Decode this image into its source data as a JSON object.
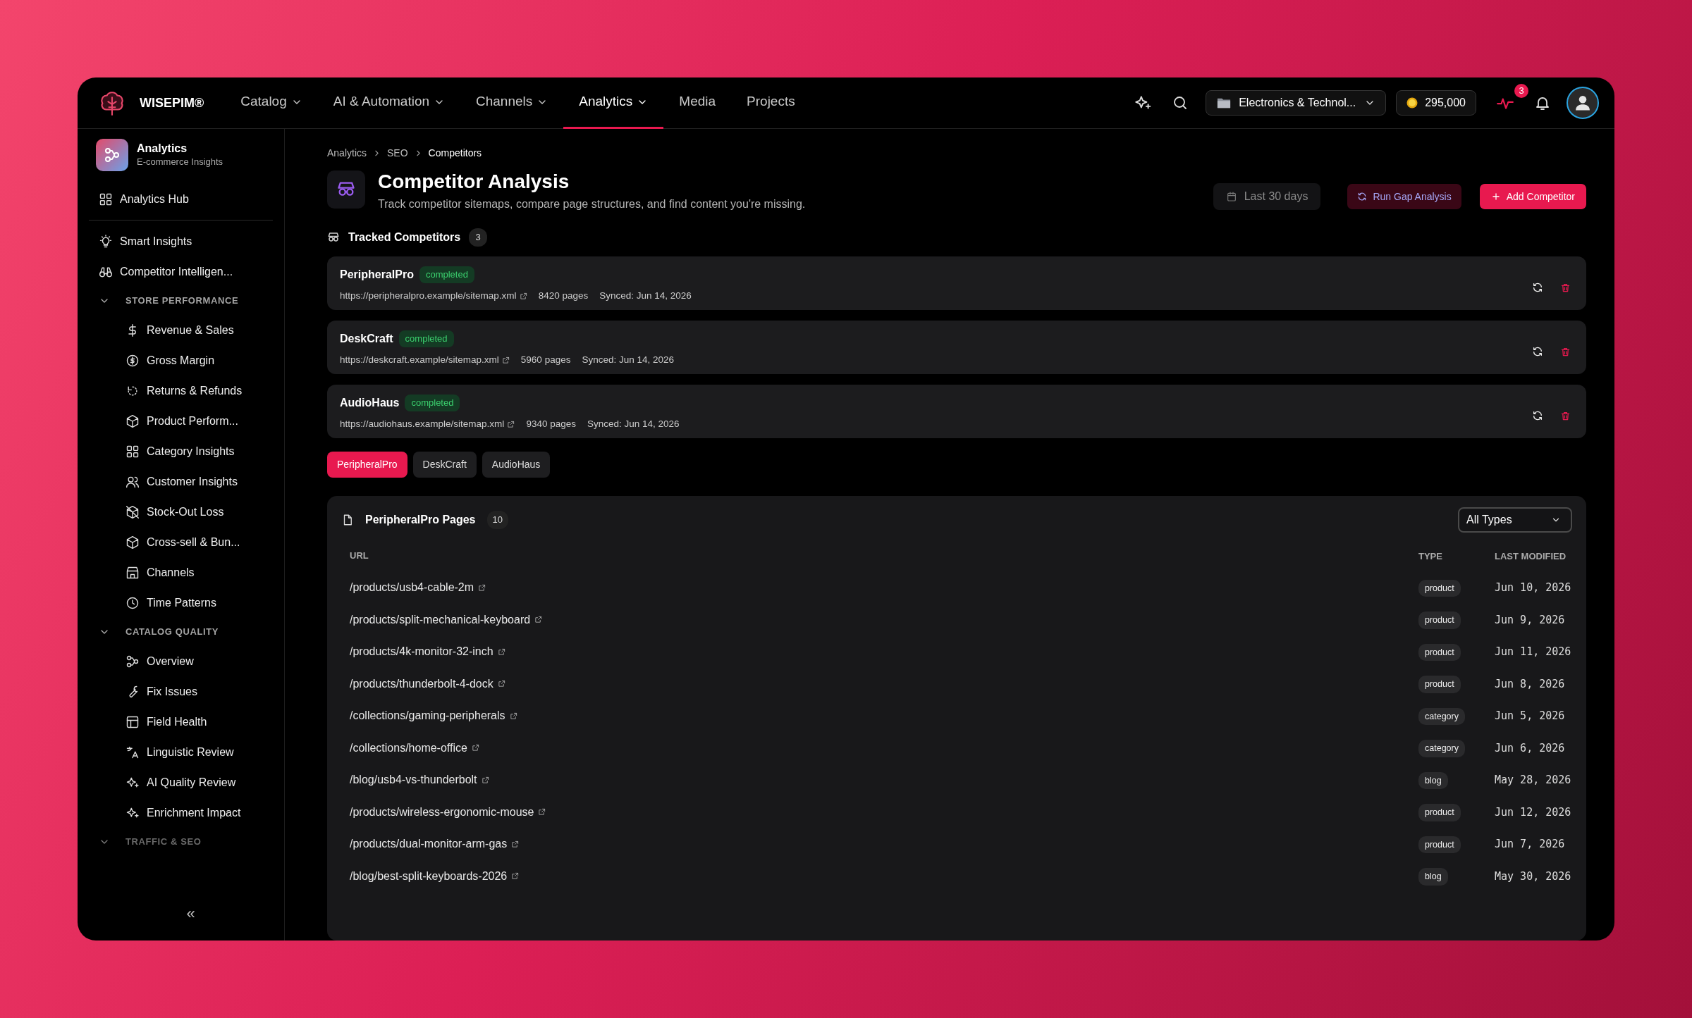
{
  "brand": {
    "name": "WISEPIM®"
  },
  "nav": [
    {
      "label": "Catalog",
      "has_menu": true,
      "selected": false
    },
    {
      "label": "AI & Automation",
      "has_menu": true,
      "selected": false
    },
    {
      "label": "Channels",
      "has_menu": true,
      "selected": false
    },
    {
      "label": "Analytics",
      "has_menu": true,
      "selected": true
    },
    {
      "label": "Media",
      "has_menu": false,
      "selected": false
    },
    {
      "label": "Projects",
      "has_menu": false,
      "selected": false
    }
  ],
  "topbar": {
    "workspace": "Electronics & Technol...",
    "credits": "295,000",
    "alerts_badge": "3"
  },
  "sidebar": {
    "header": {
      "title": "Analytics",
      "subtitle": "E-commerce Insights"
    },
    "sections": [
      {
        "items": [
          {
            "label": "Analytics Hub"
          }
        ]
      },
      {
        "items": [
          {
            "label": "Smart Insights"
          },
          {
            "label": "Competitor Intelligen..."
          }
        ]
      }
    ],
    "groups": [
      {
        "title": "STORE PERFORMANCE",
        "expanded": true,
        "items": [
          {
            "label": "Revenue & Sales"
          },
          {
            "label": "Gross Margin"
          },
          {
            "label": "Returns & Refunds"
          },
          {
            "label": "Product Perform..."
          },
          {
            "label": "Category Insights"
          },
          {
            "label": "Customer Insights"
          },
          {
            "label": "Stock-Out Loss"
          },
          {
            "label": "Cross-sell & Bun..."
          },
          {
            "label": "Channels"
          },
          {
            "label": "Time Patterns"
          }
        ]
      },
      {
        "title": "CATALOG QUALITY",
        "expanded": true,
        "items": [
          {
            "label": "Overview"
          },
          {
            "label": "Fix Issues"
          },
          {
            "label": "Field Health"
          },
          {
            "label": "Linguistic Review"
          },
          {
            "label": "AI Quality Review"
          },
          {
            "label": "Enrichment Impact"
          }
        ]
      },
      {
        "title": "TRAFFIC & SEO",
        "expanded": true
      }
    ],
    "collapse": "«"
  },
  "breadcrumb": [
    "Analytics",
    "SEO",
    "Competitors"
  ],
  "header": {
    "title": "Competitor Analysis",
    "subtitle": "Track competitor sitemaps, compare page structures, and find content you're missing.",
    "date_range": "Last 30 days",
    "buttons": [
      {
        "label": "Run Gap Analysis",
        "kind": "secondary"
      },
      {
        "label": "Add Competitor",
        "kind": "primary"
      }
    ]
  },
  "tracked": {
    "title": "Tracked Competitors",
    "count": "3",
    "competitors": [
      {
        "name": "PeripheralPro",
        "status": "completed",
        "url": "https://peripheralpro.example/sitemap.xml",
        "pages": "8420 pages",
        "synced": "Synced: Jun 14, 2026"
      },
      {
        "name": "DeskCraft",
        "status": "completed",
        "url": "https://deskcraft.example/sitemap.xml",
        "pages": "5960 pages",
        "synced": "Synced: Jun 14, 2026"
      },
      {
        "name": "AudioHaus",
        "status": "completed",
        "url": "https://audiohaus.example/sitemap.xml",
        "pages": "9340 pages",
        "synced": "Synced: Jun 14, 2026"
      }
    ]
  },
  "tabs": [
    {
      "label": "PeripheralPro",
      "selected": true
    },
    {
      "label": "DeskCraft",
      "selected": false
    },
    {
      "label": "AudioHaus",
      "selected": false
    }
  ],
  "pages": {
    "title": "PeripheralPro Pages",
    "count": "10",
    "filter": "All Types",
    "columns": [
      "URL",
      "TYPE",
      "LAST MODIFIED"
    ],
    "rows": [
      {
        "url": "/products/usb4-cable-2m",
        "type": "product",
        "modified": "Jun 10, 2026"
      },
      {
        "url": "/products/split-mechanical-keyboard",
        "type": "product",
        "modified": "Jun 9, 2026"
      },
      {
        "url": "/products/4k-monitor-32-inch",
        "type": "product",
        "modified": "Jun 11, 2026"
      },
      {
        "url": "/products/thunderbolt-4-dock",
        "type": "product",
        "modified": "Jun 8, 2026"
      },
      {
        "url": "/collections/gaming-peripherals",
        "type": "category",
        "modified": "Jun 5, 2026"
      },
      {
        "url": "/collections/home-office",
        "type": "category",
        "modified": "Jun 6, 2026"
      },
      {
        "url": "/blog/usb4-vs-thunderbolt",
        "type": "blog",
        "modified": "May 28, 2026"
      },
      {
        "url": "/products/wireless-ergonomic-mouse",
        "type": "product",
        "modified": "Jun 12, 2026"
      },
      {
        "url": "/products/dual-monitor-arm-gas",
        "type": "product",
        "modified": "Jun 7, 2026"
      },
      {
        "url": "/blog/best-split-keyboards-2026",
        "type": "blog",
        "modified": "May 30, 2026"
      }
    ]
  }
}
